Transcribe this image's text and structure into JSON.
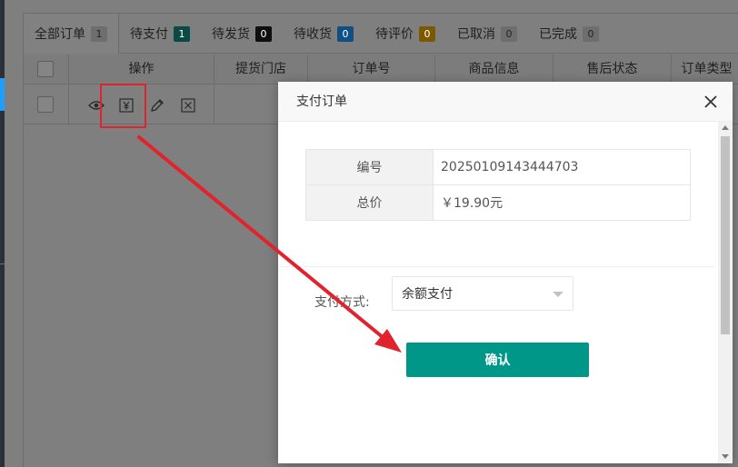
{
  "tabs": [
    {
      "label": "全部订单",
      "count": "1"
    },
    {
      "label": "待支付",
      "count": "1"
    },
    {
      "label": "待发货",
      "count": "0"
    },
    {
      "label": "待收货",
      "count": "0"
    },
    {
      "label": "待评价",
      "count": "0"
    },
    {
      "label": "已取消",
      "count": "0"
    },
    {
      "label": "已完成",
      "count": "0"
    }
  ],
  "table": {
    "headers": {
      "operation": "操作",
      "store": "提货门店",
      "order_no": "订单号",
      "product": "商品信息",
      "after_sales": "售后状态",
      "order_type": "订单类型"
    },
    "row_icons": [
      "eye-icon",
      "yuan-icon",
      "pencil-icon",
      "close-box-icon"
    ]
  },
  "modal": {
    "title": "支付订单",
    "fields": [
      {
        "label": "编号",
        "value": "20250109143444703"
      },
      {
        "label": "总价",
        "value": "￥19.90元"
      }
    ],
    "payment_label": "支付方式:",
    "payment_method": "余额支付",
    "confirm_label": "确认"
  },
  "colors": {
    "primary": "#009688",
    "annotation": "#e0232c"
  }
}
